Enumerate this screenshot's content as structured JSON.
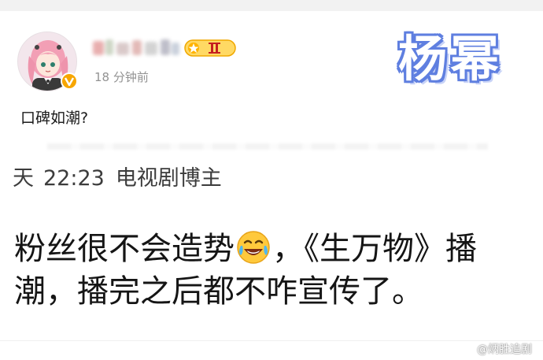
{
  "post": {
    "timestamp": "18 分钟前",
    "text": "口碑如潮?"
  },
  "watermark": {
    "title": "杨幂",
    "credit": "@炳胜追剧"
  },
  "quoted": {
    "date_fragment": "天",
    "time": "22:23",
    "role": "电视剧博主",
    "line1_before": "粉丝很不会造势",
    "line1_after": "，《生万物》播",
    "line2": "潮，播完之后都不咋宣传了。"
  },
  "icons": {
    "verified": "verified-badge-icon",
    "level": "level-badge-icon",
    "emoji": "laughing-tears-emoji-icon",
    "weibo": "weibo-logo-icon"
  },
  "colors": {
    "watermark_outline": "#5f7fe0",
    "verified_badge": "#f7a600",
    "level_badge": "#f5b400"
  }
}
